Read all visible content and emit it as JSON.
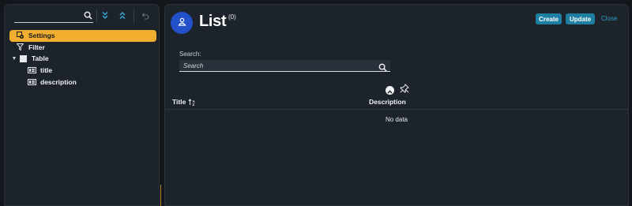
{
  "outline": {
    "search_placeholder": "",
    "toolbar_icons": [
      "search-icon",
      "expand-all-icon",
      "collapse-all-icon",
      "undo-icon"
    ],
    "items": [
      {
        "label": "Settings",
        "icon": "settings-icon",
        "selected": true
      },
      {
        "label": "Filter",
        "icon": "filter-icon"
      },
      {
        "label": "Table",
        "icon": "table-icon",
        "expanded": true
      },
      {
        "label": "title",
        "icon": "column-icon"
      },
      {
        "label": "description",
        "icon": "column-icon"
      }
    ]
  },
  "header": {
    "title": "List",
    "count": "(0)",
    "avatar_icon": "user-icon",
    "create_label": "Create",
    "update_label": "Update",
    "close_label": "Close"
  },
  "search": {
    "label": "Search:",
    "placeholder": "Search"
  },
  "table": {
    "columns": [
      {
        "label": "Title",
        "sort_icon": "sort-ascending-icon"
      },
      {
        "label": "Description"
      }
    ],
    "empty_text": "No data"
  },
  "colors": {
    "accent_selected": "#f2ae2e",
    "button": "#1f7fa3",
    "avatar": "#2251c9",
    "link": "#2e9ec7",
    "panel": "#1d232b",
    "background": "#13161b"
  }
}
